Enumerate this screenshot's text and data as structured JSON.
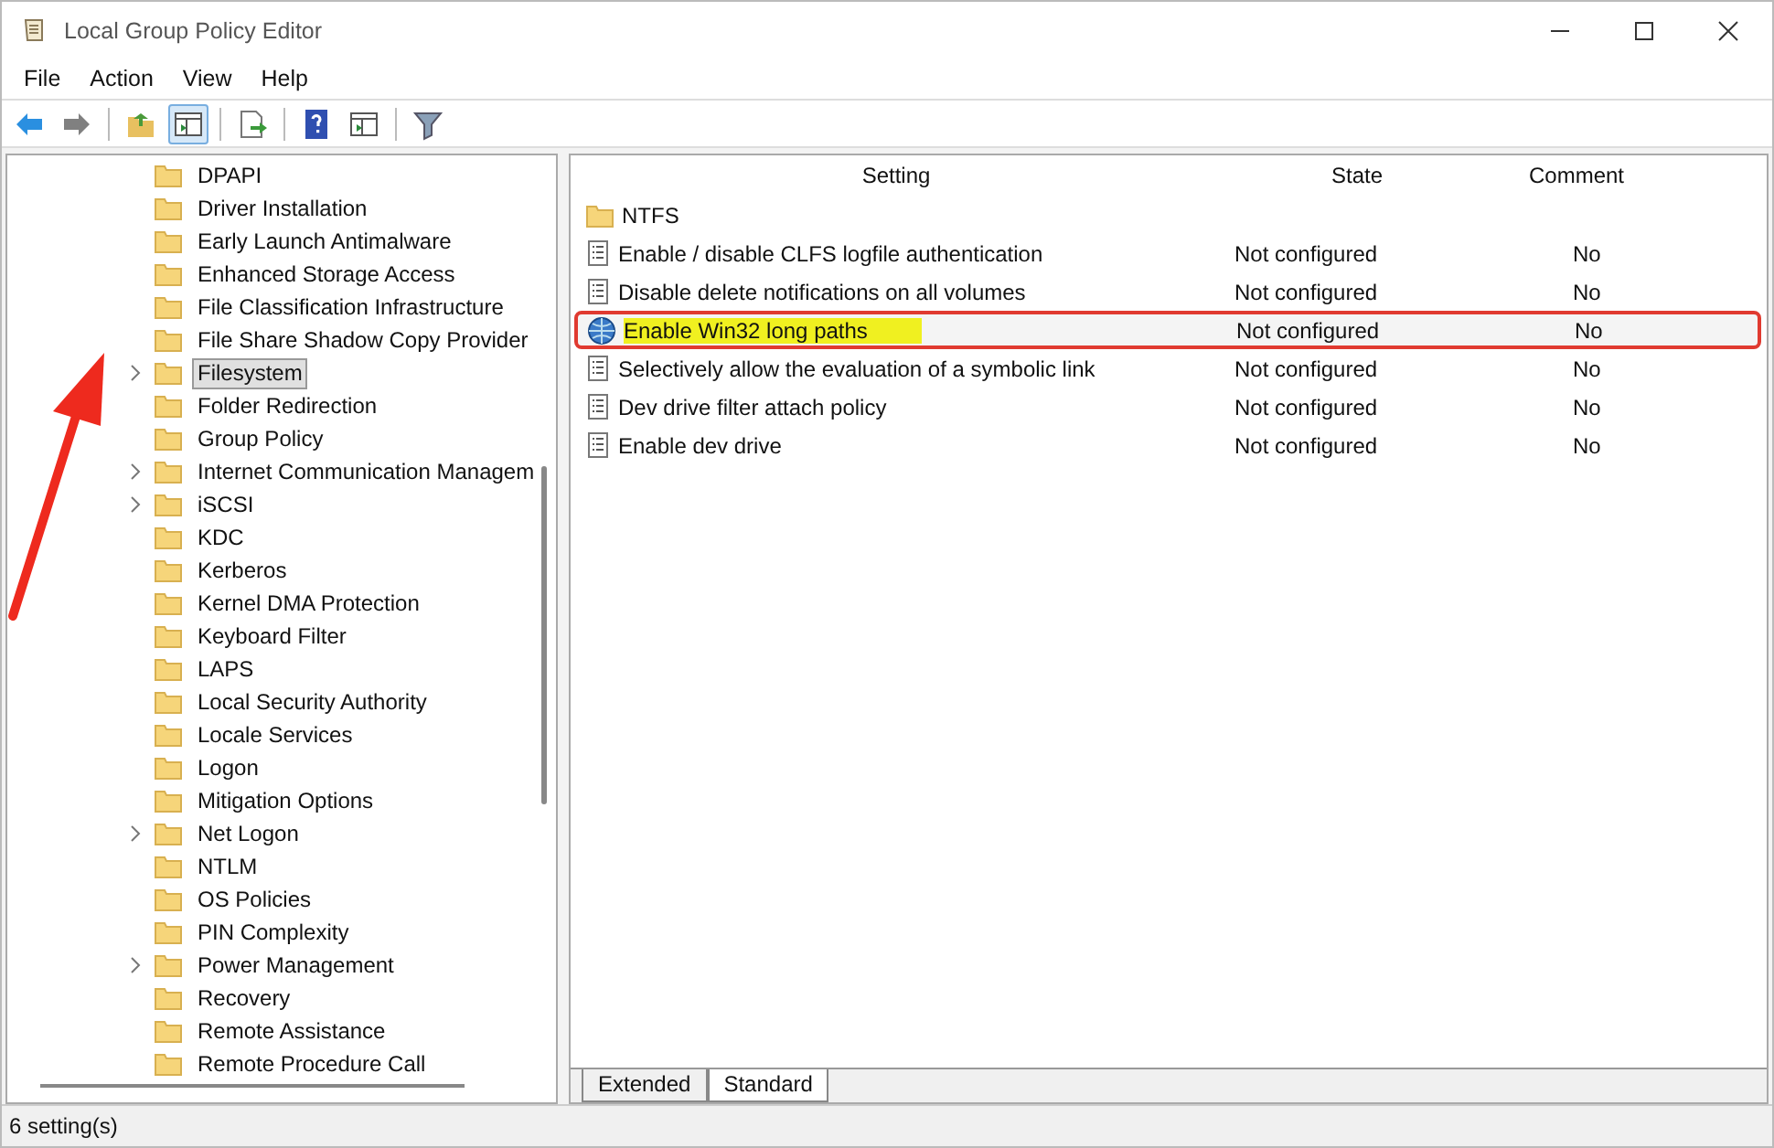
{
  "window": {
    "title": "Local Group Policy Editor"
  },
  "menu": [
    "File",
    "Action",
    "View",
    "Help"
  ],
  "toolbar": [
    {
      "kind": "back",
      "pressed": false
    },
    {
      "kind": "forward",
      "pressed": false
    },
    {
      "kind": "up",
      "pressed": false
    },
    {
      "kind": "tree",
      "pressed": true
    },
    {
      "kind": "export",
      "pressed": false
    },
    {
      "kind": "help",
      "pressed": false
    },
    {
      "kind": "panel",
      "pressed": false
    },
    {
      "kind": "filter",
      "pressed": false
    }
  ],
  "tree": [
    {
      "label": "DPAPI",
      "expandable": false,
      "selected": false
    },
    {
      "label": "Driver Installation",
      "expandable": false,
      "selected": false
    },
    {
      "label": "Early Launch Antimalware",
      "expandable": false,
      "selected": false
    },
    {
      "label": "Enhanced Storage Access",
      "expandable": false,
      "selected": false
    },
    {
      "label": "File Classification Infrastructure",
      "expandable": false,
      "selected": false
    },
    {
      "label": "File Share Shadow Copy Provider",
      "expandable": false,
      "selected": false
    },
    {
      "label": "Filesystem",
      "expandable": true,
      "selected": true
    },
    {
      "label": "Folder Redirection",
      "expandable": false,
      "selected": false
    },
    {
      "label": "Group Policy",
      "expandable": false,
      "selected": false
    },
    {
      "label": "Internet Communication Managem",
      "expandable": true,
      "selected": false
    },
    {
      "label": "iSCSI",
      "expandable": true,
      "selected": false
    },
    {
      "label": "KDC",
      "expandable": false,
      "selected": false
    },
    {
      "label": "Kerberos",
      "expandable": false,
      "selected": false
    },
    {
      "label": "Kernel DMA Protection",
      "expandable": false,
      "selected": false
    },
    {
      "label": "Keyboard Filter",
      "expandable": false,
      "selected": false
    },
    {
      "label": "LAPS",
      "expandable": false,
      "selected": false
    },
    {
      "label": "Local Security Authority",
      "expandable": false,
      "selected": false
    },
    {
      "label": "Locale Services",
      "expandable": false,
      "selected": false
    },
    {
      "label": "Logon",
      "expandable": false,
      "selected": false
    },
    {
      "label": "Mitigation Options",
      "expandable": false,
      "selected": false
    },
    {
      "label": "Net Logon",
      "expandable": true,
      "selected": false
    },
    {
      "label": "NTLM",
      "expandable": false,
      "selected": false
    },
    {
      "label": "OS Policies",
      "expandable": false,
      "selected": false
    },
    {
      "label": "PIN Complexity",
      "expandable": false,
      "selected": false
    },
    {
      "label": "Power Management",
      "expandable": true,
      "selected": false
    },
    {
      "label": "Recovery",
      "expandable": false,
      "selected": false
    },
    {
      "label": "Remote Assistance",
      "expandable": false,
      "selected": false
    },
    {
      "label": "Remote Procedure Call",
      "expandable": false,
      "selected": false
    }
  ],
  "table": {
    "columns": [
      "Setting",
      "State",
      "Comment"
    ],
    "rows": [
      {
        "kind": "folder",
        "setting": "NTFS",
        "highlighted": false
      },
      {
        "kind": "setting",
        "setting": "Enable / disable CLFS logfile authentication",
        "state": "Not configured",
        "comment": "No",
        "highlighted": false
      },
      {
        "kind": "setting",
        "setting": "Disable delete notifications on all volumes",
        "state": "Not configured",
        "comment": "No",
        "highlighted": false
      },
      {
        "kind": "globe-setting",
        "setting": "Enable Win32 long paths",
        "state": "Not configured",
        "comment": "No",
        "highlighted": true
      },
      {
        "kind": "setting",
        "setting": "Selectively allow the evaluation of a symbolic link",
        "state": "Not configured",
        "comment": "No",
        "highlighted": false
      },
      {
        "kind": "setting",
        "setting": "Dev drive filter attach policy",
        "state": "Not configured",
        "comment": "No",
        "highlighted": false
      },
      {
        "kind": "setting",
        "setting": "Enable dev drive",
        "state": "Not configured",
        "comment": "No",
        "highlighted": false
      }
    ]
  },
  "tabs": [
    {
      "label": "Extended",
      "selected": false
    },
    {
      "label": "Standard",
      "selected": true
    }
  ],
  "status_bar": "6 setting(s)"
}
